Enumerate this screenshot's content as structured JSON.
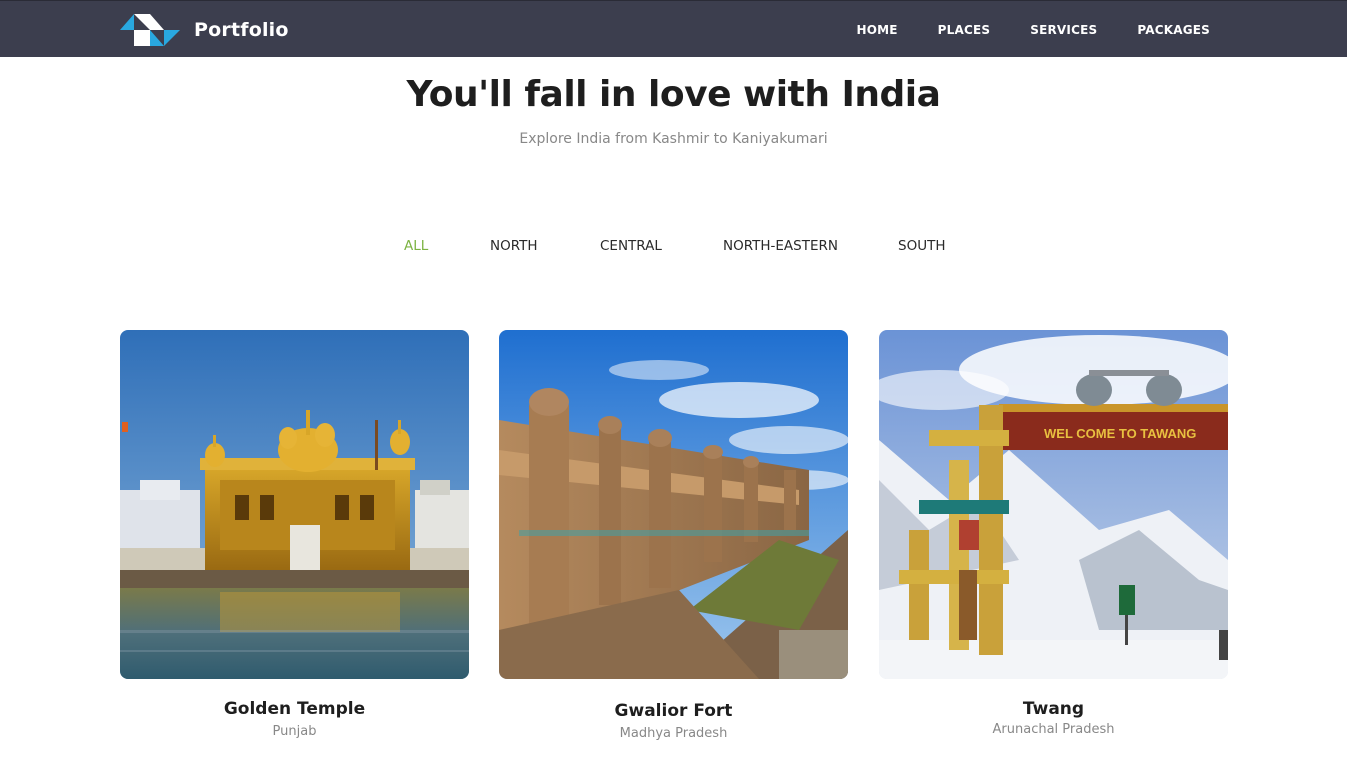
{
  "header": {
    "brand": "Portfolio",
    "nav": [
      "HOME",
      "PLACES",
      "SERVICES",
      "PACKAGES"
    ]
  },
  "hero": {
    "title": "You'll fall in love with India",
    "subtitle": "Explore India from Kashmir to Kaniyakumari"
  },
  "filters": {
    "items": [
      "ALL",
      "NORTH",
      "CENTRAL",
      "NORTH-EASTERN",
      "SOUTH"
    ],
    "active": "ALL"
  },
  "cards": [
    {
      "title": "Golden Temple",
      "subtitle": "Punjab"
    },
    {
      "title": "Gwalior Fort",
      "subtitle": "Madhya Pradesh"
    },
    {
      "title": "Twang",
      "subtitle": "Arunachal Pradesh",
      "sign_text": "WEL COME TO TAWANG"
    }
  ],
  "colors": {
    "navbar": "#3c3e4e",
    "accent": "#7cb342",
    "logo_blue": "#29a8e0"
  }
}
